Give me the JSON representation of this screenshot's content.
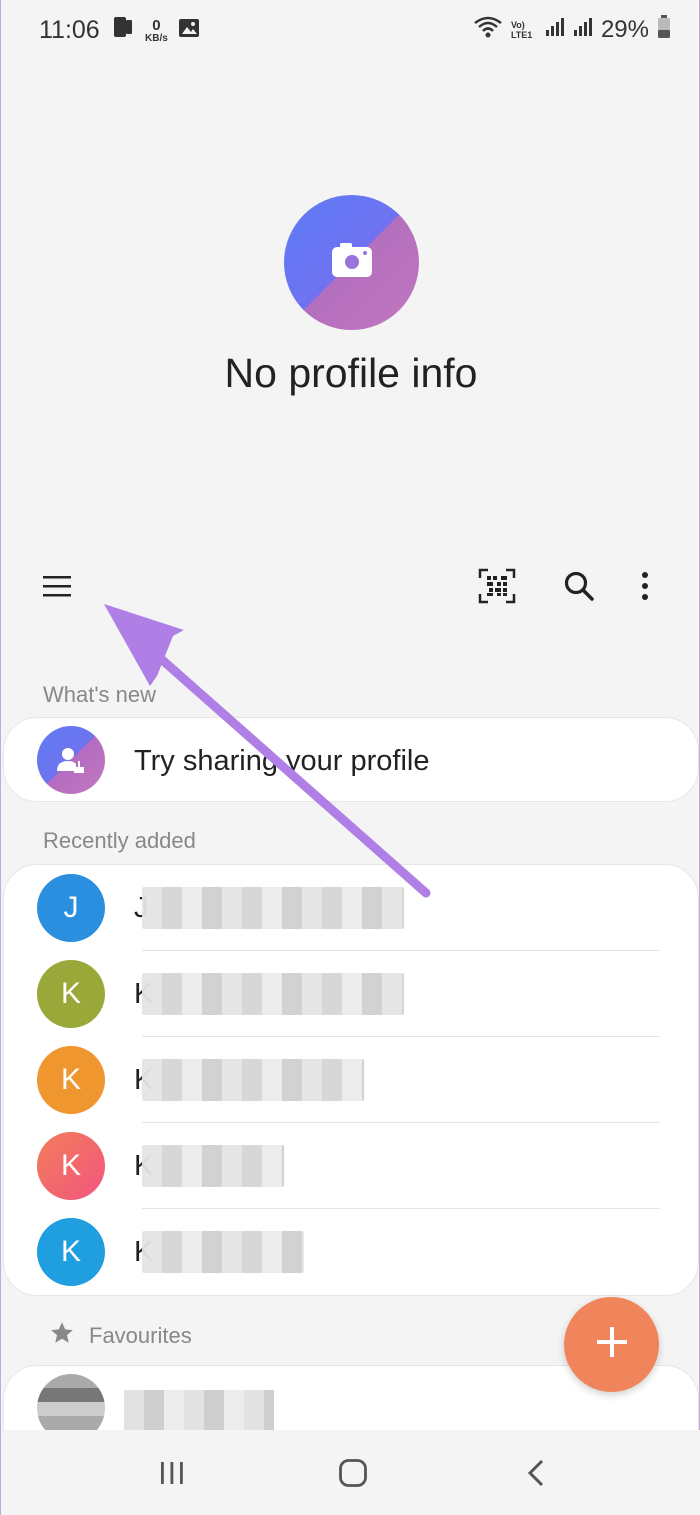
{
  "status_bar": {
    "time": "11:06",
    "netspeed_value": "0",
    "netspeed_unit": "KB/s",
    "network_label": "Vo) LTE1",
    "battery": "29%"
  },
  "profile": {
    "name": "No profile info"
  },
  "sections": {
    "whats_new": "What's new",
    "recently_added": "Recently added",
    "favourites": "Favourites"
  },
  "share_card": {
    "text": "Try sharing your profile"
  },
  "recent_contacts": [
    {
      "initial": "J",
      "color": "#2b8fe0"
    },
    {
      "initial": "K",
      "color": "#9aa83a"
    },
    {
      "initial": "K",
      "color": "#f0962e"
    },
    {
      "initial": "K",
      "color": "#f2656e"
    },
    {
      "initial": "K",
      "color": "#1f9ee0"
    }
  ],
  "colors": {
    "fab": "#f0845a",
    "arrow": "#b07fe6",
    "profile_gradient_a": "#6173f4",
    "profile_gradient_b": "#c276c0"
  }
}
